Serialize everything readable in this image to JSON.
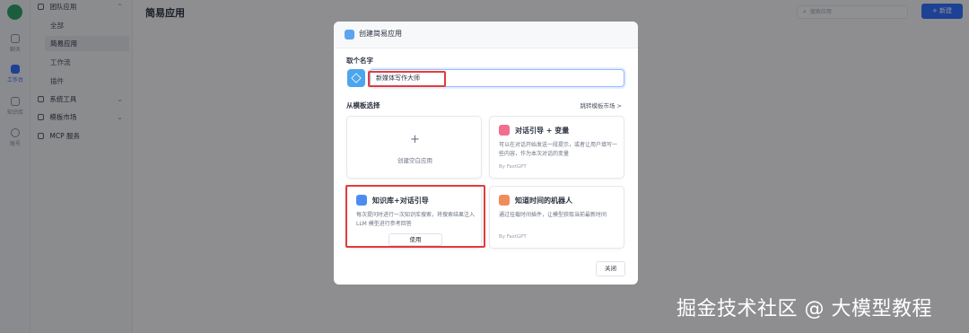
{
  "rail": {
    "avatar_letter": "",
    "items": [
      {
        "label": "聊天",
        "icon": "chat-icon"
      },
      {
        "label": "工作台",
        "icon": "robot-icon"
      },
      {
        "label": "知识库",
        "icon": "database-icon"
      },
      {
        "label": "账号",
        "icon": "user-icon"
      }
    ]
  },
  "sidebar": {
    "team_apps": "团队应用",
    "sub_items": [
      "全部",
      "简易应用",
      "工作流",
      "插件"
    ],
    "system_tools": "系统工具",
    "template_market": "模板市场",
    "mcp": "MCP 服务"
  },
  "header": {
    "title": "简易应用",
    "search_placeholder": "搜索应用",
    "new_label": "新建"
  },
  "modal": {
    "title": "创建简易应用",
    "name_label": "取个名字",
    "name_value": "新媒体写作大师",
    "template_label": "从模板选择",
    "market_link": "跳转模板市场 >",
    "blank_plus": "+",
    "blank_label": "创建空白应用",
    "cards": [
      {
        "title": "对话引导 + 变量",
        "desc": "可以在对话开始发送一段提示，或者让用户填写一些内容，作为本次对话的变量",
        "by": "By FastGPT",
        "color": "#f06e8f"
      },
      {
        "title": "知识库+对话引导",
        "desc": "每次提问时进行一次知识库搜索，将搜索结果注入 LLM 模型进行参考回答",
        "use": "使用",
        "color": "#4c8cf0"
      },
      {
        "title": "知道时间的机器人",
        "desc": "通过挂载时间插件，让模型获取当前最新时间",
        "by": "By FastGPT",
        "color": "#f28b5c"
      }
    ],
    "close_label": "关闭"
  },
  "watermark": "掘金技术社区 @ 大模型教程",
  "colors": {
    "accent": "#3370ff",
    "highlight": "#e33b3b"
  }
}
